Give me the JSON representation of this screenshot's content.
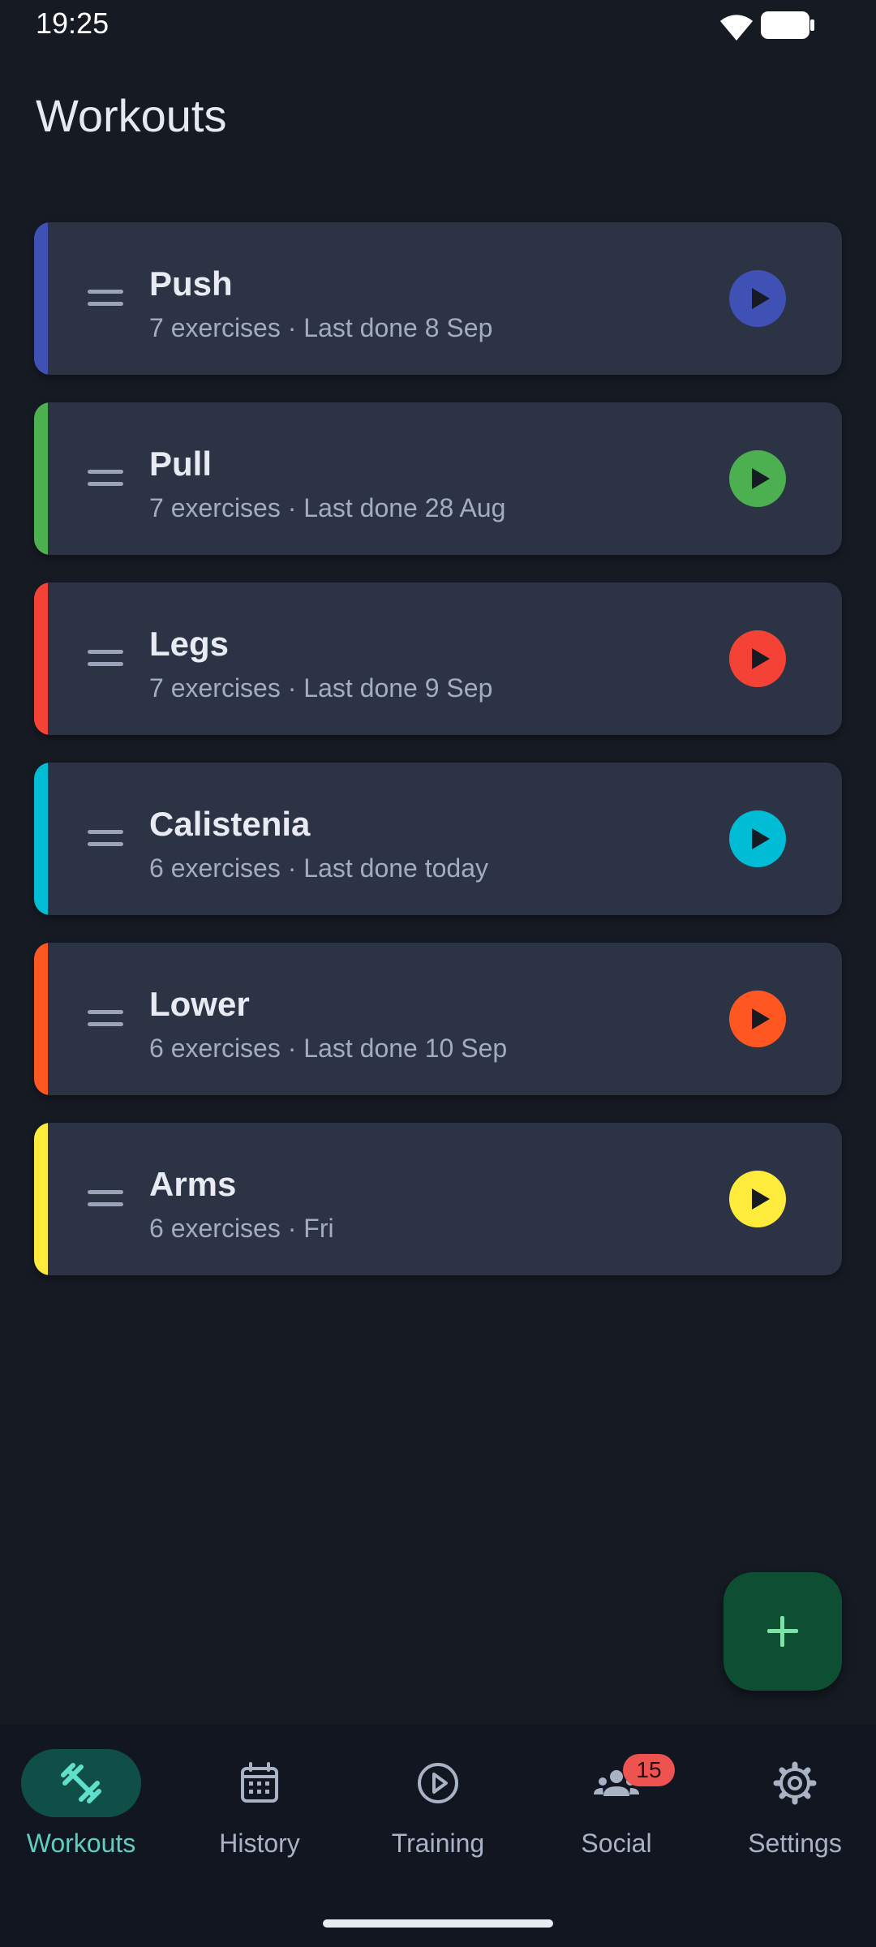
{
  "status_bar": {
    "time": "19:25"
  },
  "page": {
    "title": "Workouts"
  },
  "workouts": [
    {
      "name": "Push",
      "subtitle": "7 exercises · Last done 8 Sep",
      "color": "#3f51b5"
    },
    {
      "name": "Pull",
      "subtitle": "7 exercises · Last done 28 Aug",
      "color": "#4caf50"
    },
    {
      "name": "Legs",
      "subtitle": "7 exercises · Last done 9 Sep",
      "color": "#f44336"
    },
    {
      "name": "Calistenia",
      "subtitle": "6 exercises · Last done today",
      "color": "#00bcd4"
    },
    {
      "name": "Lower",
      "subtitle": "6 exercises · Last done 10 Sep",
      "color": "#ff5722"
    },
    {
      "name": "Arms",
      "subtitle": "6 exercises · Fri",
      "color": "#ffeb3b"
    }
  ],
  "fab": {
    "icon": "plus-icon"
  },
  "bottom_nav": {
    "items": [
      {
        "label": "Workouts",
        "icon": "dumbbell-icon",
        "active": true
      },
      {
        "label": "History",
        "icon": "calendar-icon",
        "active": false
      },
      {
        "label": "Training",
        "icon": "play-circle-icon",
        "active": false
      },
      {
        "label": "Social",
        "icon": "group-icon",
        "active": false,
        "badge": "15"
      },
      {
        "label": "Settings",
        "icon": "gear-icon",
        "active": false
      }
    ]
  },
  "colors": {
    "background": "#161a23",
    "card": "#2b3345",
    "accent": "#5fcfc0",
    "fab": "#0e4f34"
  }
}
